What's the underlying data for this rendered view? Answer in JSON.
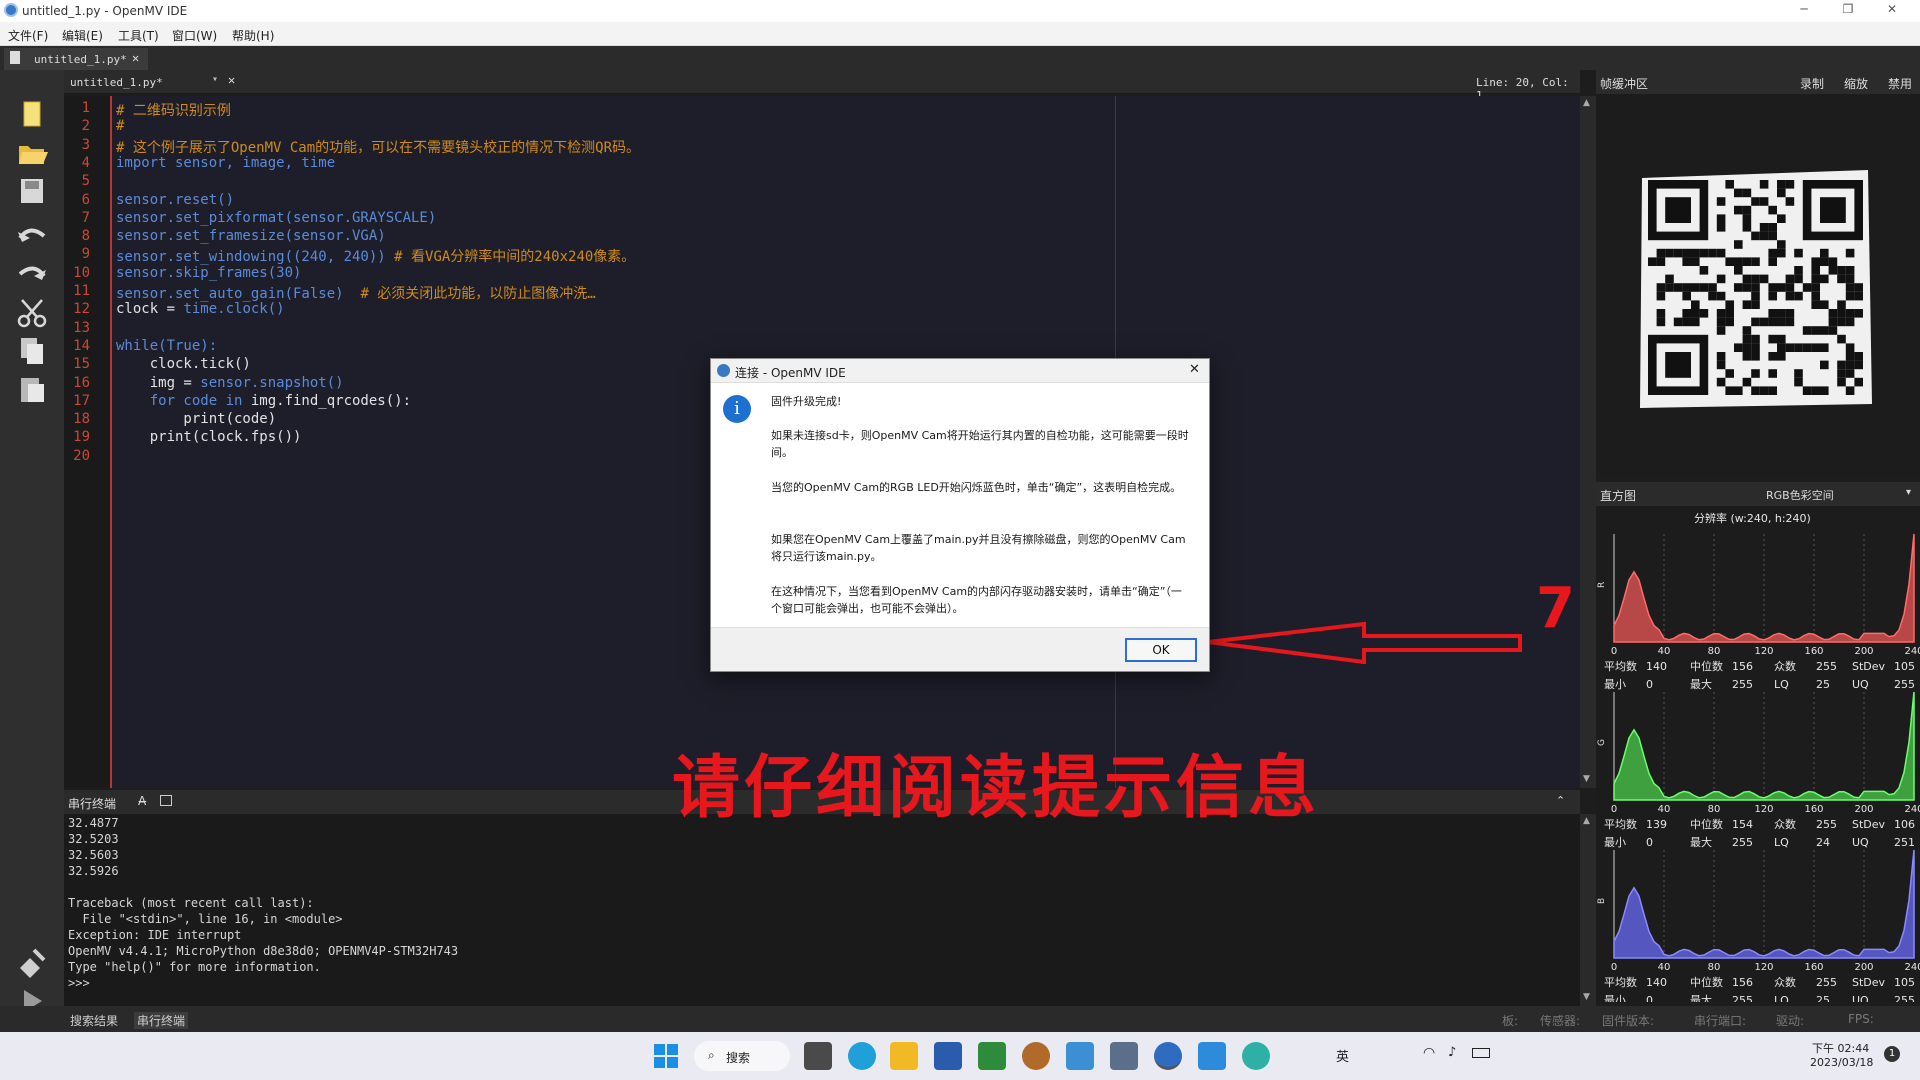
{
  "window": {
    "title": "untitled_1.py - OpenMV IDE"
  },
  "menu": [
    "文件(F)",
    "编辑(E)",
    "工具(T)",
    "窗口(W)",
    "帮助(H)"
  ],
  "doc_tab": {
    "label": "untitled_1.py*"
  },
  "editor": {
    "file_label": "untitled_1.py*",
    "cursor": "Line: 20, Col: 1",
    "lines": [
      {
        "n": "1",
        "parts": [
          {
            "t": "# 二维码识别示例",
            "c": "cm"
          }
        ]
      },
      {
        "n": "2",
        "parts": [
          {
            "t": "#",
            "c": "cm"
          }
        ]
      },
      {
        "n": "3",
        "parts": [
          {
            "t": "# 这个例子展示了OpenMV Cam的功能，可以在不需要镜头校正的情况下检测QR码。",
            "c": "cm"
          }
        ]
      },
      {
        "n": "4",
        "parts": [
          {
            "t": "import sensor, image, time",
            "c": "kw"
          }
        ]
      },
      {
        "n": "5",
        "parts": []
      },
      {
        "n": "6",
        "parts": [
          {
            "t": "sensor.reset()",
            "c": "kw"
          }
        ]
      },
      {
        "n": "7",
        "parts": [
          {
            "t": "sensor.set_pixformat(sensor.GRAYSCALE)",
            "c": "kw"
          }
        ]
      },
      {
        "n": "8",
        "parts": [
          {
            "t": "sensor.set_framesize(sensor.VGA)",
            "c": "kw"
          }
        ]
      },
      {
        "n": "9",
        "parts": [
          {
            "t": "sensor.set_windowing((240, 240)) ",
            "c": "kw"
          },
          {
            "t": "# 看VGA分辨率中间的240x240像素。",
            "c": "cm"
          }
        ]
      },
      {
        "n": "10",
        "parts": [
          {
            "t": "sensor.skip_frames(30)",
            "c": "kw"
          }
        ]
      },
      {
        "n": "11",
        "parts": [
          {
            "t": "sensor.set_auto_gain(False)  ",
            "c": "kw"
          },
          {
            "t": "# 必须关闭此功能，以防止图像冲洗…",
            "c": "cm"
          }
        ]
      },
      {
        "n": "12",
        "parts": [
          {
            "t": "clock = ",
            "c": "fn"
          },
          {
            "t": "time.clock()",
            "c": "kw"
          }
        ]
      },
      {
        "n": "13",
        "parts": []
      },
      {
        "n": "14",
        "parts": [
          {
            "t": "while(True):",
            "c": "kw"
          }
        ]
      },
      {
        "n": "15",
        "parts": [
          {
            "t": "    clock.tick()",
            "c": "fn"
          }
        ]
      },
      {
        "n": "16",
        "parts": [
          {
            "t": "    img = ",
            "c": "fn"
          },
          {
            "t": "sensor.snapshot()",
            "c": "kw"
          }
        ]
      },
      {
        "n": "17",
        "parts": [
          {
            "t": "    for code in ",
            "c": "kw"
          },
          {
            "t": "img.find_qrcodes():",
            "c": "fn"
          }
        ]
      },
      {
        "n": "18",
        "parts": [
          {
            "t": "        print(code)",
            "c": "fn"
          }
        ]
      },
      {
        "n": "19",
        "parts": [
          {
            "t": "    print(clock.fps())",
            "c": "fn"
          }
        ]
      },
      {
        "n": "20",
        "parts": []
      }
    ]
  },
  "framebuffer": {
    "title": "帧缓冲区",
    "record": "录制",
    "zoom": "缩放",
    "disable": "禁用"
  },
  "histogram": {
    "title": "直方图",
    "colorspace": "RGB色彩空间",
    "resolution": "分辨率 (w:240, h:240)",
    "ticks": [
      "0",
      "40",
      "80",
      "120",
      "160",
      "200",
      "240"
    ],
    "channels": [
      {
        "name": "R",
        "color": "#ff6b6b",
        "fill": "#b84747",
        "stats": [
          "平均数",
          "140",
          "中位数",
          "156",
          "众数",
          "255",
          "StDev",
          "105",
          "最小",
          "0",
          "最大",
          "255",
          "LQ",
          "25",
          "UQ",
          "255"
        ]
      },
      {
        "name": "G",
        "color": "#6bff6b",
        "fill": "#3fa03f",
        "stats": [
          "平均数",
          "139",
          "中位数",
          "154",
          "众数",
          "255",
          "StDev",
          "106",
          "最小",
          "0",
          "最大",
          "255",
          "LQ",
          "24",
          "UQ",
          "251"
        ]
      },
      {
        "name": "B",
        "color": "#8a8aff",
        "fill": "#5656c0",
        "stats": [
          "平均数",
          "140",
          "中位数",
          "156",
          "众数",
          "255",
          "StDev",
          "105",
          "最小",
          "0",
          "最大",
          "255",
          "LQ",
          "25",
          "UQ",
          "255"
        ]
      }
    ]
  },
  "serial": {
    "title": "串行终端",
    "lines": [
      "32.4877",
      "32.5203",
      "32.5603",
      "32.5926",
      "",
      "Traceback (most recent call last):",
      "  File \"<stdin>\", line 16, in <module>",
      "Exception: IDE interrupt",
      "OpenMV v4.4.1; MicroPython d8e38d0; OPENMV4P-STM32H743",
      "Type \"help()\" for more information.",
      ">>>"
    ]
  },
  "status": {
    "tab_search": "搜索结果",
    "tab_serial": "串行终端",
    "items": [
      "板:",
      "传感器:",
      "固件版本:",
      "串行端口:",
      "驱动:",
      "FPS:"
    ]
  },
  "dialog": {
    "title": "连接 - OpenMV IDE",
    "heading": "固件升级完成!",
    "paragraphs": [
      "如果未连接sd卡，则OpenMV Cam将开始运行其内置的自检功能，这可能需要一段时间。",
      "当您的OpenMV Cam的RGB LED开始闪烁蓝色时，单击“确定”，这表明自检完成。",
      "如果您在OpenMV Cam上覆盖了main.py并且没有擦除磁盘，则您的OpenMV Cam将只运行该main.py。",
      "在这种情况下，当您看到OpenMV Cam的内部闪存驱动器安装时，请单击“确定”（一个窗口可能会弹出，也可能不会弹出）。"
    ],
    "ok": "OK"
  },
  "annotation": {
    "text": "请仔细阅读提示信息",
    "number": "7",
    "color": "#e6171d"
  },
  "taskbar": {
    "search": "搜索",
    "ime": "英",
    "time": "下午 02:44",
    "date": "2023/03/18",
    "notification": "1"
  }
}
